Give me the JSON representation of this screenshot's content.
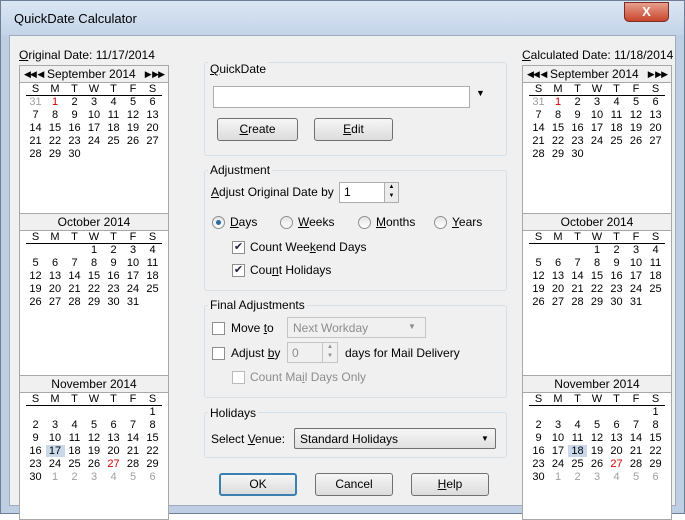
{
  "window": {
    "title": "QuickDate Calculator",
    "close_glyph": "X"
  },
  "left": {
    "caption_ul": "O",
    "caption_rest": "riginal Date:",
    "value": "11/17/2014",
    "months": [
      {
        "name": "September 2014",
        "nav": true,
        "weeks": [
          [
            "31",
            "1",
            "2",
            "3",
            "4",
            "5",
            "6"
          ],
          [
            "7",
            "8",
            "9",
            "10",
            "11",
            "12",
            "13"
          ],
          [
            "14",
            "15",
            "16",
            "17",
            "18",
            "19",
            "20"
          ],
          [
            "21",
            "22",
            "23",
            "24",
            "25",
            "26",
            "27"
          ],
          [
            "28",
            "29",
            "30",
            "",
            "",
            "",
            ""
          ]
        ]
      },
      {
        "name": "October 2014",
        "weeks": [
          [
            "",
            "",
            "",
            "1",
            "2",
            "3",
            "4"
          ],
          [
            "5",
            "6",
            "7",
            "8",
            "9",
            "10",
            "11"
          ],
          [
            "12",
            "13",
            "14",
            "15",
            "16",
            "17",
            "18"
          ],
          [
            "19",
            "20",
            "21",
            "22",
            "23",
            "24",
            "25"
          ],
          [
            "26",
            "27",
            "28",
            "29",
            "30",
            "31",
            ""
          ]
        ]
      },
      {
        "name": "November 2014",
        "weeks": [
          [
            "",
            "",
            "",
            "",
            "",
            "",
            "1"
          ],
          [
            "2",
            "3",
            "4",
            "5",
            "6",
            "7",
            "8"
          ],
          [
            "9",
            "10",
            "11",
            "12",
            "13",
            "14",
            "15"
          ],
          [
            "16",
            "17",
            "18",
            "19",
            "20",
            "21",
            "22"
          ],
          [
            "23",
            "24",
            "25",
            "26",
            "27",
            "28",
            "29"
          ],
          [
            "30",
            "1",
            "2",
            "3",
            "4",
            "5",
            "6"
          ]
        ]
      }
    ]
  },
  "right": {
    "caption_ul": "C",
    "caption_rest": "alculated Date:",
    "value": "11/18/2014",
    "months": [
      {
        "name": "September 2014",
        "nav": true,
        "weeks": [
          [
            "31",
            "1",
            "2",
            "3",
            "4",
            "5",
            "6"
          ],
          [
            "7",
            "8",
            "9",
            "10",
            "11",
            "12",
            "13"
          ],
          [
            "14",
            "15",
            "16",
            "17",
            "18",
            "19",
            "20"
          ],
          [
            "21",
            "22",
            "23",
            "24",
            "25",
            "26",
            "27"
          ],
          [
            "28",
            "29",
            "30",
            "",
            "",
            "",
            ""
          ]
        ]
      },
      {
        "name": "October 2014",
        "weeks": [
          [
            "",
            "",
            "",
            "1",
            "2",
            "3",
            "4"
          ],
          [
            "5",
            "6",
            "7",
            "8",
            "9",
            "10",
            "11"
          ],
          [
            "12",
            "13",
            "14",
            "15",
            "16",
            "17",
            "18"
          ],
          [
            "19",
            "20",
            "21",
            "22",
            "23",
            "24",
            "25"
          ],
          [
            "26",
            "27",
            "28",
            "29",
            "30",
            "31",
            ""
          ]
        ]
      },
      {
        "name": "November 2014",
        "weeks": [
          [
            "",
            "",
            "",
            "",
            "",
            "",
            "1"
          ],
          [
            "2",
            "3",
            "4",
            "5",
            "6",
            "7",
            "8"
          ],
          [
            "9",
            "10",
            "11",
            "12",
            "13",
            "14",
            "15"
          ],
          [
            "16",
            "17",
            "18",
            "19",
            "20",
            "21",
            "22"
          ],
          [
            "23",
            "24",
            "25",
            "26",
            "27",
            "28",
            "29"
          ],
          [
            "30",
            "1",
            "2",
            "3",
            "4",
            "5",
            "6"
          ]
        ]
      }
    ]
  },
  "dow": [
    "S",
    "M",
    "T",
    "W",
    "T",
    "F",
    "S"
  ],
  "quickdate": {
    "group_ul": "Q",
    "group_rest": "uickDate",
    "input_value": "",
    "create_ul": "C",
    "create_rest": "reate",
    "edit_ul": "E",
    "edit_rest": "dit"
  },
  "adjustment": {
    "group": "Adjustment",
    "label_pre": "A",
    "label_ul": "d",
    "label_post": "just Original Date by",
    "value": "1",
    "days_ul": "D",
    "days_rest": "ays",
    "weeks_ul": "W",
    "weeks_rest": "eeks",
    "months_ul": "M",
    "months_rest": "onths",
    "years_ul": "Y",
    "years_rest": "ears",
    "cw_pre": "Count Wee",
    "cw_ul": "k",
    "cw_post": "end Days",
    "ch_pre": "Cou",
    "ch_ul": "n",
    "ch_post": "t Holidays"
  },
  "final": {
    "group": "Final Adjustments",
    "move_pre": "Move ",
    "move_ul": "t",
    "move_post": "o",
    "move_select": "Next Workday",
    "adj_pre": "Adjust ",
    "adj_ul": "b",
    "adj_post": "y",
    "adj_value": "0",
    "adj_suffix": "days for Mail Delivery",
    "cm_pre": "Count Ma",
    "cm_ul": "i",
    "cm_post": "l Days Only"
  },
  "holidays": {
    "group": "Holidays",
    "label_pre": "Select ",
    "label_ul": "V",
    "label_post": "enue:",
    "selected": "Standard Holidays"
  },
  "buttons": {
    "ok": "OK",
    "cancel": "Cancel",
    "help_ul": "H",
    "help_rest": "elp"
  }
}
